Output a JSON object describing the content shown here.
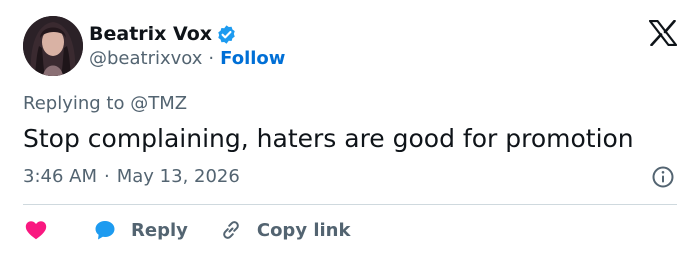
{
  "author": {
    "display_name": "Beatrix Vox",
    "handle": "@beatrixvox",
    "separator": "·",
    "follow_label": "Follow",
    "verified": true
  },
  "tweet": {
    "replying_prefix": "Replying to",
    "replying_to": "@TMZ",
    "text": "Stop complaining, haters are good for promotion",
    "time": "3:46 AM",
    "date_separator": "·",
    "date": "May 13, 2026"
  },
  "actions": {
    "reply_label": "Reply",
    "copy_link_label": "Copy link"
  },
  "icons": {
    "verified": "verified-badge-icon",
    "logo": "x-logo-icon",
    "info": "info-icon",
    "like": "heart-icon",
    "reply": "speech-bubble-icon",
    "copy": "link-icon"
  },
  "colors": {
    "accent": "#006fd6",
    "verified": "#1d9bf0",
    "like": "#f91880",
    "reply": "#1d9bf0",
    "text": "#0f1419",
    "muted": "#536471",
    "divider": "#cfd9de"
  }
}
